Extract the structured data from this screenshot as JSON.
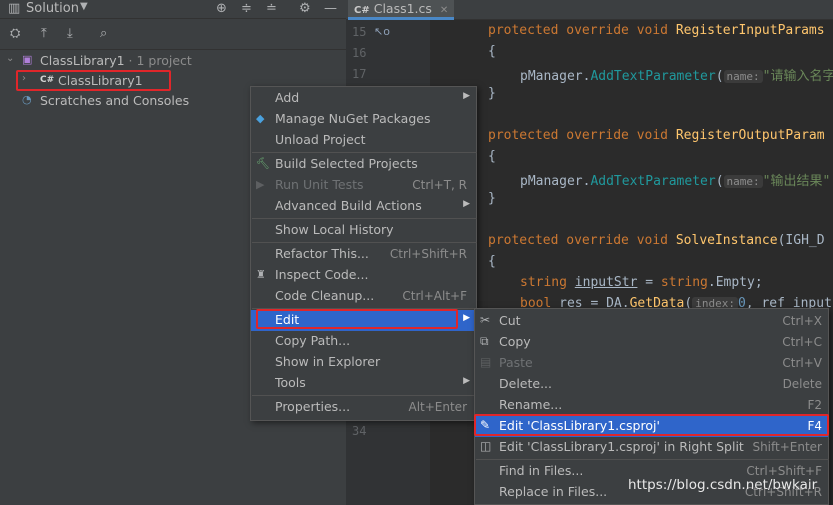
{
  "solution_panel": {
    "title": "Solution",
    "tree": {
      "root_label": "ClassLibrary1",
      "root_sub": "· 1 project",
      "project_label": "ClassLibrary1",
      "project_badge": "C#",
      "scratches_label": "Scratches and Consoles"
    }
  },
  "editor": {
    "tab_label": "Class1.cs",
    "tab_badge": "C#",
    "line_numbers": [
      "15",
      "16",
      "17",
      "34"
    ],
    "code": {
      "l1_kw": "protected override void ",
      "l1_fn": "RegisterInputParams",
      "brace_open": "{",
      "brace_close": "}",
      "l3_obj": "pManager.",
      "l3_fn": "AddTextParameter",
      "l3_hint": "name:",
      "l3_str": "\"请输入名字",
      "l6_kw": "protected override void ",
      "l6_fn": "RegisterOutputParam",
      "l8_str": "\"输出结果\"",
      "l11_kw": "protected override void ",
      "l11_fn": "SolveInstance",
      "l11_rest": "(IGH_D",
      "l13_kw": "string ",
      "l13_var": "inputStr",
      "l13_mid": " = ",
      "l13_kw2": "string",
      "l13_end": ".Empty;",
      "l14_kw": "bool ",
      "l14_rest": "res = DA.",
      "l14_fn": "GetData",
      "l14_hint": "index:",
      "l14_val": "0",
      "l14_end": ", ref input",
      "l34": "}"
    }
  },
  "context_menu": {
    "items": [
      {
        "label": "Add",
        "shortcut": ""
      },
      {
        "label": "Manage NuGet Packages",
        "shortcut": ""
      },
      {
        "label": "Unload Project",
        "shortcut": ""
      },
      {
        "label": "Build Selected Projects",
        "shortcut": ""
      },
      {
        "label": "Run Unit Tests",
        "shortcut": "Ctrl+T, R"
      },
      {
        "label": "Advanced Build Actions",
        "shortcut": ""
      },
      {
        "label": "Show Local History",
        "shortcut": ""
      },
      {
        "label": "Refactor This...",
        "shortcut": "Ctrl+Shift+R"
      },
      {
        "label": "Inspect Code...",
        "shortcut": ""
      },
      {
        "label": "Code Cleanup...",
        "shortcut": "Ctrl+Alt+F"
      },
      {
        "label": "Edit",
        "shortcut": ""
      },
      {
        "label": "Copy Path...",
        "shortcut": ""
      },
      {
        "label": "Show in Explorer",
        "shortcut": ""
      },
      {
        "label": "Tools",
        "shortcut": ""
      },
      {
        "label": "Properties...",
        "shortcut": "Alt+Enter"
      }
    ]
  },
  "edit_submenu": {
    "items": [
      {
        "label": "Cut",
        "shortcut": "Ctrl+X"
      },
      {
        "label": "Copy",
        "shortcut": "Ctrl+C"
      },
      {
        "label": "Paste",
        "shortcut": "Ctrl+V"
      },
      {
        "label": "Delete...",
        "shortcut": "Delete"
      },
      {
        "label": "Rename...",
        "shortcut": "F2"
      },
      {
        "label": "Edit 'ClassLibrary1.csproj'",
        "shortcut": "F4"
      },
      {
        "label": "Edit 'ClassLibrary1.csproj' in Right Split",
        "shortcut": "Shift+Enter"
      },
      {
        "label": "Find in Files...",
        "shortcut": "Ctrl+Shift+F"
      },
      {
        "label": "Replace in Files...",
        "shortcut": "Ctrl+Shift+R"
      }
    ]
  },
  "watermark": "https://blog.csdn.net/bwkair",
  "colors": {
    "selection": "#2f65ca",
    "highlight_box": "#e0262a",
    "keyword": "#cc7832",
    "method": "#ffc66d"
  }
}
